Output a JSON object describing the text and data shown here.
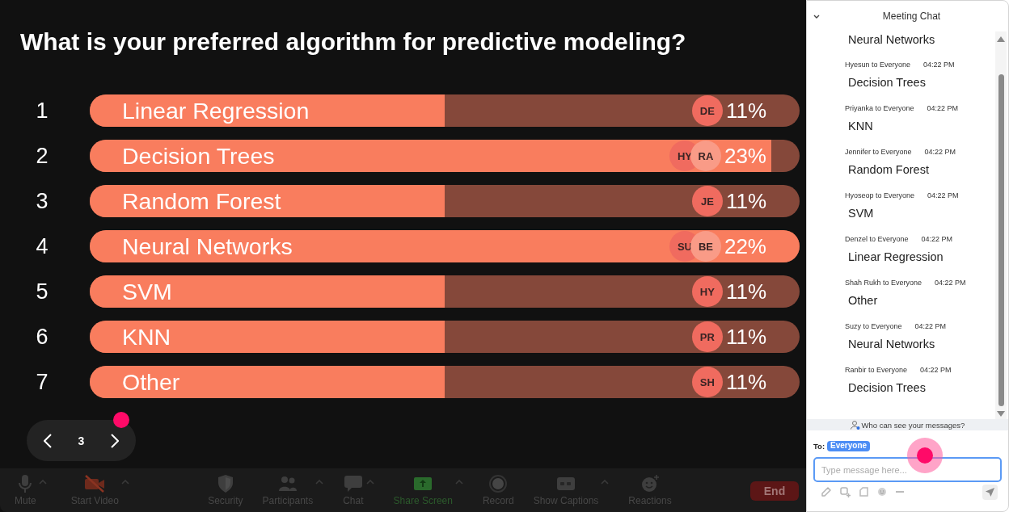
{
  "poll": {
    "question": "What is your preferred algorithm for predictive modeling?",
    "options": [
      {
        "number": "1",
        "label": "Linear Regression",
        "level": 0.5,
        "voters": [
          "DE"
        ],
        "percent": "11%"
      },
      {
        "number": "2",
        "label": "Decision Trees",
        "level": 0.96,
        "voters": [
          "HY",
          "RA"
        ],
        "percent": "23%"
      },
      {
        "number": "3",
        "label": "Random Forest",
        "level": 0.5,
        "voters": [
          "JE"
        ],
        "percent": "11%"
      },
      {
        "number": "4",
        "label": "Neural Networks",
        "level": 1,
        "voters": [
          "SU",
          "BE"
        ],
        "percent": "22%"
      },
      {
        "number": "5",
        "label": "SVM",
        "level": 0.5,
        "voters": [
          "HY"
        ],
        "percent": "11%"
      },
      {
        "number": "6",
        "label": "KNN",
        "level": 0.5,
        "voters": [
          "PR"
        ],
        "percent": "11%"
      },
      {
        "number": "7",
        "label": "Other",
        "level": 0.5,
        "voters": [
          "SH"
        ],
        "percent": "11%"
      }
    ]
  },
  "pager": {
    "page": "3"
  },
  "toolbar": {
    "left": [
      {
        "label": "Mute",
        "kind": "mute",
        "caret": true
      },
      {
        "label": "Start Video",
        "kind": "video",
        "caret": true
      }
    ],
    "center": [
      {
        "label": "Security",
        "kind": "security",
        "caret": false
      },
      {
        "label": "Participants",
        "kind": "participants",
        "caret": true
      },
      {
        "label": "Chat",
        "kind": "chat",
        "caret": true
      },
      {
        "label": "Share Screen",
        "kind": "share-screen",
        "caret": true
      },
      {
        "label": "Record",
        "kind": "record",
        "caret": false
      },
      {
        "label": "Show Captions",
        "kind": "captions",
        "caret": true
      },
      {
        "label": "Reactions",
        "kind": "reactions",
        "caret": false
      }
    ],
    "end_button": "End"
  },
  "chat": {
    "title": "Meeting Chat",
    "messages": [
      {
        "text": "Neural Networks"
      },
      {
        "sender": "Hyesun to Everyone",
        "time": "04:22 PM",
        "text": "Decision Trees"
      },
      {
        "sender": "Priyanka to Everyone",
        "time": "04:22 PM",
        "text": "KNN"
      },
      {
        "sender": "Jennifer to Everyone",
        "time": "04:22 PM",
        "text": "Random Forest"
      },
      {
        "sender": "Hyoseop to Everyone",
        "time": "04:22 PM",
        "text": "SVM"
      },
      {
        "sender": "Denzel to Everyone",
        "time": "04:22 PM",
        "text": "Linear Regression"
      },
      {
        "sender": "Shah Rukh to Everyone",
        "time": "04:22 PM",
        "text": "Other"
      },
      {
        "sender": "Suzy to Everyone",
        "time": "04:22 PM",
        "text": "Neural Networks"
      },
      {
        "sender": "Ranbir to Everyone",
        "time": "04:22 PM",
        "text": "Decision Trees"
      }
    ],
    "privacy_note": "Who can see your messages?",
    "to_label": "To:",
    "recipient": "Everyone",
    "placeholder": "Type message here..."
  }
}
